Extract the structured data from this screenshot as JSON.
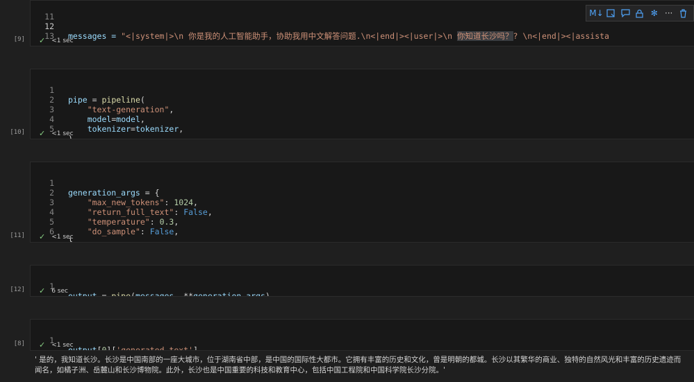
{
  "cells": [
    {
      "exec": "[9]",
      "time": "<1 sec",
      "lines": [
        {
          "n": "11",
          "code": ""
        },
        {
          "n": "12",
          "code": "messages"
        },
        {
          "n": "13",
          "code": ""
        }
      ],
      "messages_prefix": "messages = ",
      "messages_str_a": "\"<|system|>\\n 你是我的人工智能助手，协助我用中文解答问题.\\n<|end|><|user|>\\n ",
      "messages_str_highlight": "你知道长沙吗？",
      "messages_str_b": "? \\n<|end|><|assista"
    },
    {
      "exec": "[10]",
      "time": "<1 sec",
      "lines": [
        {
          "n": "1",
          "parts": [
            [
              "k-var",
              "pipe"
            ],
            [
              "k-op",
              " = "
            ],
            [
              "k-fn",
              "pipeline"
            ],
            [
              "k-op",
              "("
            ]
          ]
        },
        {
          "n": "2",
          "parts": [
            [
              "k-op",
              "    "
            ],
            [
              "k-str",
              "\"text-generation\""
            ],
            [
              "k-op",
              ","
            ]
          ]
        },
        {
          "n": "3",
          "parts": [
            [
              "k-op",
              "    "
            ],
            [
              "k-var",
              "model"
            ],
            [
              "k-op",
              "="
            ],
            [
              "k-var",
              "model"
            ],
            [
              "k-op",
              ","
            ]
          ]
        },
        {
          "n": "4",
          "parts": [
            [
              "k-op",
              "    "
            ],
            [
              "k-var",
              "tokenizer"
            ],
            [
              "k-op",
              "="
            ],
            [
              "k-var",
              "tokenizer"
            ],
            [
              "k-op",
              ","
            ]
          ]
        },
        {
          "n": "5",
          "parts": [
            [
              "k-op",
              ")"
            ]
          ]
        }
      ]
    },
    {
      "exec": "[11]",
      "time": "<1 sec",
      "lines": [
        {
          "n": "1",
          "parts": [
            [
              "k-var",
              "generation_args"
            ],
            [
              "k-op",
              " = {"
            ]
          ]
        },
        {
          "n": "2",
          "parts": [
            [
              "k-op",
              "    "
            ],
            [
              "k-str",
              "\"max_new_tokens\""
            ],
            [
              "k-op",
              ": "
            ],
            [
              "k-num",
              "1024"
            ],
            [
              "k-op",
              ","
            ]
          ]
        },
        {
          "n": "3",
          "parts": [
            [
              "k-op",
              "    "
            ],
            [
              "k-str",
              "\"return_full_text\""
            ],
            [
              "k-op",
              ": "
            ],
            [
              "k-bool",
              "False"
            ],
            [
              "k-op",
              ","
            ]
          ]
        },
        {
          "n": "4",
          "parts": [
            [
              "k-op",
              "    "
            ],
            [
              "k-str",
              "\"temperature\""
            ],
            [
              "k-op",
              ": "
            ],
            [
              "k-num",
              "0.3"
            ],
            [
              "k-op",
              ","
            ]
          ]
        },
        {
          "n": "5",
          "parts": [
            [
              "k-op",
              "    "
            ],
            [
              "k-str",
              "\"do_sample\""
            ],
            [
              "k-op",
              ": "
            ],
            [
              "k-bool",
              "False"
            ],
            [
              "k-op",
              ","
            ]
          ]
        },
        {
          "n": "6",
          "parts": [
            [
              "k-op",
              "}"
            ]
          ]
        }
      ]
    },
    {
      "exec": "[12]",
      "time": "6 sec",
      "lines": [
        {
          "n": "1",
          "parts": [
            [
              "k-var",
              "output"
            ],
            [
              "k-op",
              " = "
            ],
            [
              "k-fn",
              "pipe"
            ],
            [
              "k-op",
              "("
            ],
            [
              "k-var",
              "messages"
            ],
            [
              "k-op",
              ", **"
            ],
            [
              "k-var",
              "generation_args"
            ],
            [
              "k-op",
              ")"
            ]
          ]
        }
      ]
    },
    {
      "exec": "[8]",
      "time": "<1 sec",
      "lines": [
        {
          "n": "1",
          "parts": [
            [
              "k-var",
              "output"
            ],
            [
              "k-op",
              "["
            ],
            [
              "k-num",
              "0"
            ],
            [
              "k-op",
              "]["
            ],
            [
              "k-str",
              "'generated_text'"
            ],
            [
              "k-op",
              "]"
            ]
          ]
        }
      ]
    }
  ],
  "output_text": "' 是的，我知道长沙。长沙是中国南部的一座大城市，位于湖南省中部，是中国的国际性大都市。它拥有丰富的历史和文化，曾是明朝的都城。长沙以其繁华的商业、独特的自然风光和丰富的历史遗迹而闻名，如橘子洲、岳麓山和长沙博物院。此外，长沙也是中国重要的科技和教育中心，包括中国工程院和中国科学院长沙分院。'",
  "toolbar": {
    "icons": [
      "M↓",
      "▭",
      "💬",
      "🔒",
      "✻",
      "···",
      "🗑"
    ]
  },
  "colors": {
    "background": "#1f1f1f",
    "cell_bg": "#181818",
    "check": "#89d185",
    "accent": "#4fa3f7"
  }
}
